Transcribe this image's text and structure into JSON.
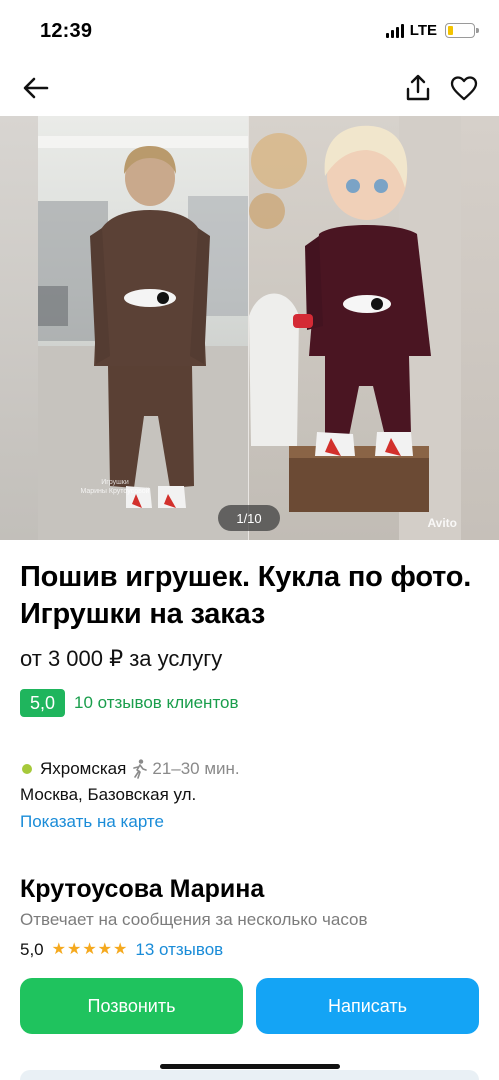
{
  "status_bar": {
    "time": "12:39",
    "network": "LTE"
  },
  "gallery": {
    "counter": "1/10",
    "watermark": "Avito",
    "caption_line1": "Игрушки",
    "caption_line2": "Марины Крутоусовой"
  },
  "listing": {
    "title": "Пошив игрушек. Кукла по фото. Игрушки на заказ",
    "price": "от 3 000 ₽ за услугу",
    "rating_value": "5,0",
    "reviews_link": "10 отзывов клиентов"
  },
  "location": {
    "metro": "Яхромская",
    "walk_time": "21–30 мин.",
    "metro_color": "#a6c93a",
    "address": "Москва, Базовская ул.",
    "map_link": "Показать на карте"
  },
  "seller": {
    "name": "Крутоусова Марина",
    "response": "Отвечает на сообщения за несколько часов",
    "score": "5,0",
    "stars": 5,
    "reviews": "13 отзывов"
  },
  "actions": {
    "call_label": "Позвонить",
    "write_label": "Написать",
    "call_color": "#1fc35e",
    "write_color": "#14a4f5"
  },
  "icons": [
    "back-arrow-icon",
    "share-icon",
    "heart-icon",
    "walk-icon",
    "star-icon"
  ]
}
